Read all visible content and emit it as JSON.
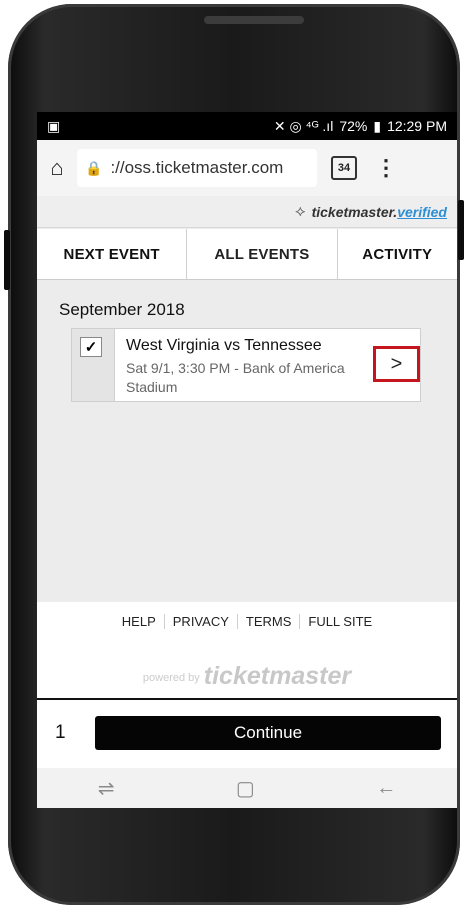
{
  "status_bar": {
    "left_icon": "image-icon",
    "icons": "✕ ◎ ⁴ᴳ .ıl",
    "battery": "72%",
    "time": "12:29 PM"
  },
  "browser": {
    "url": "://oss.ticketmaster.com",
    "tab_count": "34"
  },
  "verified_badge": {
    "brand_main": "ticketmaster.",
    "brand_accent": "verified"
  },
  "nav": {
    "tabs": [
      "NEXT EVENT",
      "ALL EVENTS",
      "ACTIVITY"
    ]
  },
  "events": {
    "month": "September 2018",
    "items": [
      {
        "title": "West Virginia vs Tennessee",
        "subtitle": "Sat 9/1, 3:30 PM - Bank of America Stadium",
        "checked": "✓",
        "arrow": ">"
      }
    ]
  },
  "footer": {
    "links": [
      "HELP",
      "PRIVACY",
      "TERMS",
      "FULL SITE"
    ],
    "powered_by": "powered by",
    "brand": "ticketmaster"
  },
  "bottom": {
    "quantity": "1",
    "continue_label": "Continue"
  },
  "colors": {
    "highlight": "#c4161c",
    "verified_accent": "#2d8fd5",
    "continue_bg": "#050505"
  }
}
